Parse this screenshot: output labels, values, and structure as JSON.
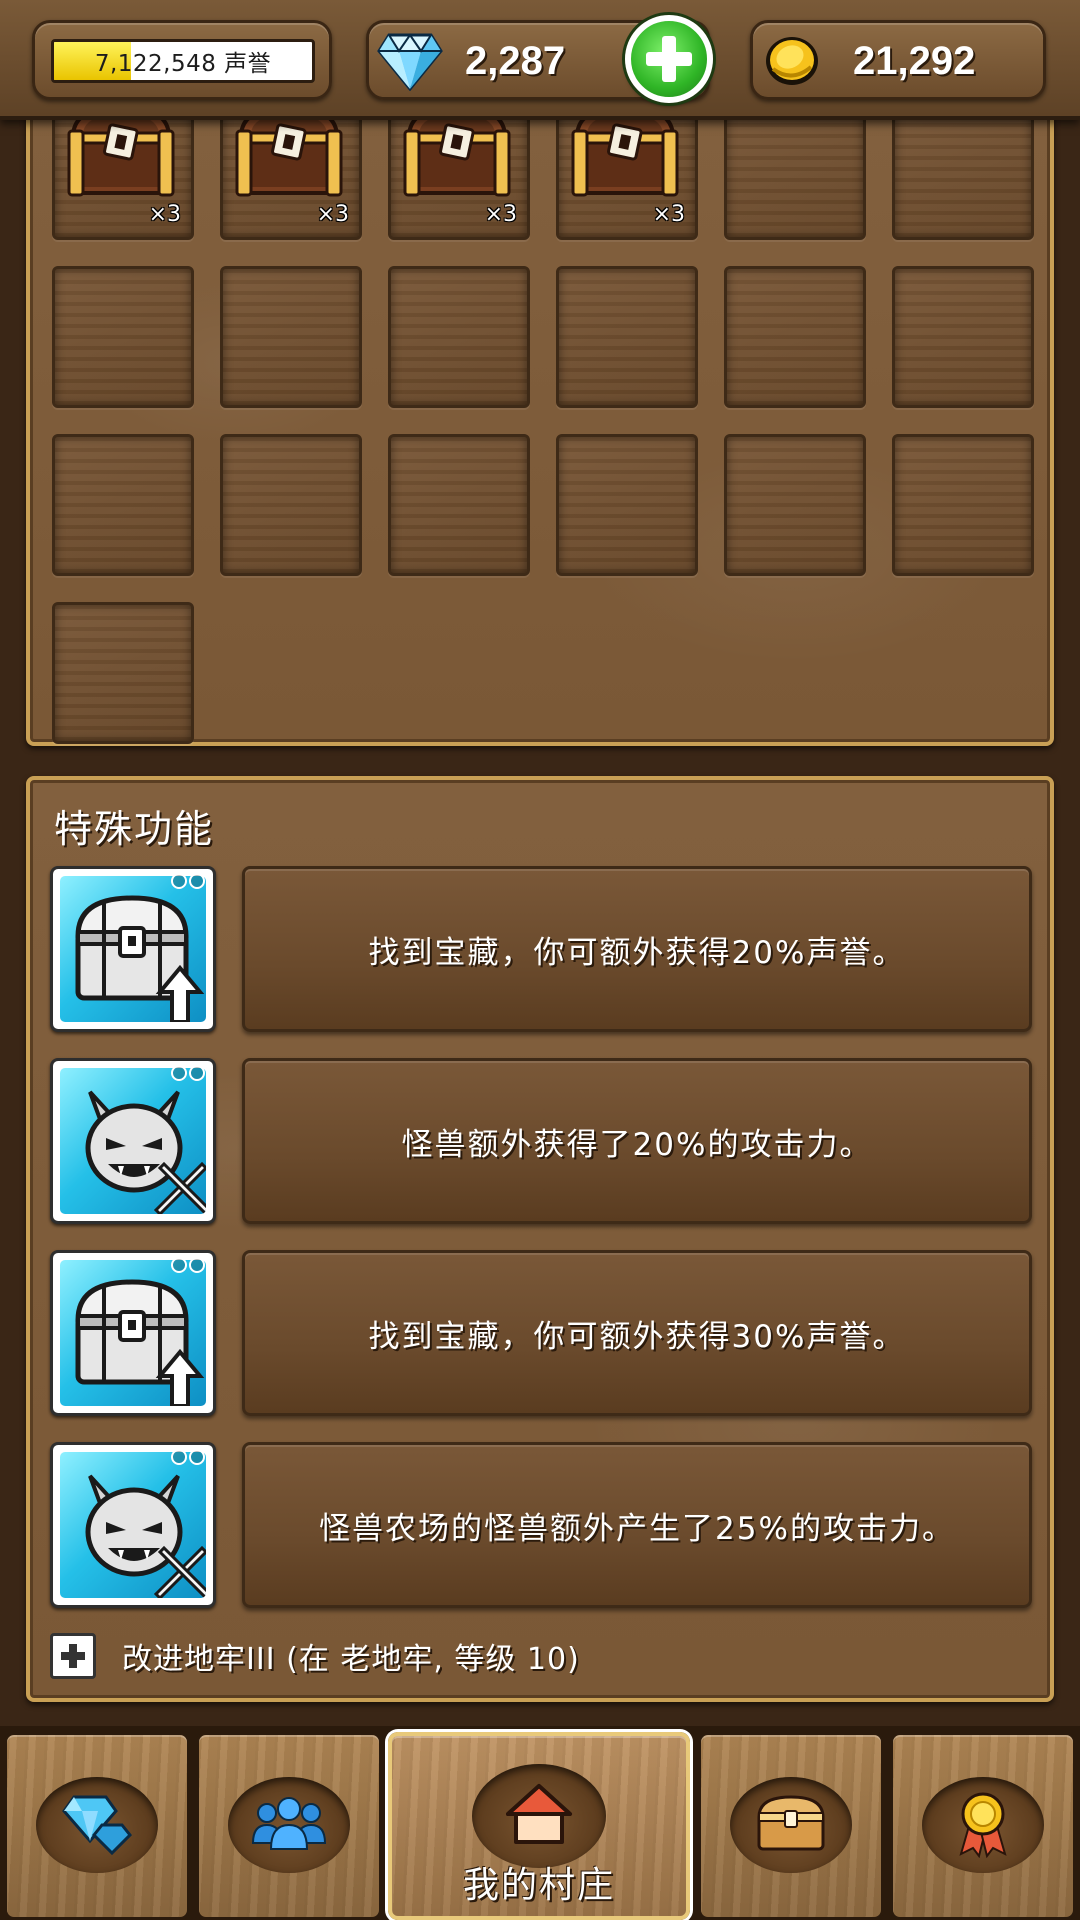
{
  "topbar": {
    "fame": {
      "text": "7,122,548 声誉",
      "fill_fraction": 0.3
    },
    "gems": {
      "value": "2,287"
    },
    "gold": {
      "value": "21,292"
    }
  },
  "inventory": {
    "slots": [
      {
        "item": "treasure-chest",
        "qty": "×3"
      },
      {
        "item": "treasure-chest",
        "qty": "×3"
      },
      {
        "item": "treasure-chest",
        "qty": "×3"
      },
      {
        "item": "treasure-chest",
        "qty": "×3"
      },
      {
        "item": null
      },
      {
        "item": null
      },
      {
        "item": null
      },
      {
        "item": null
      },
      {
        "item": null
      },
      {
        "item": null
      },
      {
        "item": null
      },
      {
        "item": null
      },
      {
        "item": null
      },
      {
        "item": null
      },
      {
        "item": null
      },
      {
        "item": null
      },
      {
        "item": null
      },
      {
        "item": null
      },
      {
        "item": null
      }
    ]
  },
  "special": {
    "title": "特殊功能",
    "features": [
      {
        "icon": "chest-up-icon",
        "text": "找到宝藏，你可额外获得20%声誉。"
      },
      {
        "icon": "monster-sword-icon",
        "text": "怪兽额外获得了20%的攻击力。"
      },
      {
        "icon": "chest-up-icon",
        "text": "找到宝藏，你可额外获得30%声誉。"
      },
      {
        "icon": "monster-sword-icon",
        "text": "怪兽农场的怪兽额外产生了25%的攻击力。"
      }
    ],
    "upgrade": {
      "text": "改进地牢III (在 老地牢, 等级 10)"
    }
  },
  "bottom_nav": {
    "items": [
      {
        "icon": "diamond-icon",
        "label": ""
      },
      {
        "icon": "people-icon",
        "label": ""
      },
      {
        "icon": "house-icon",
        "label": "我的村庄",
        "active": true
      },
      {
        "icon": "chest-icon",
        "label": ""
      },
      {
        "icon": "medal-icon",
        "label": ""
      }
    ]
  },
  "colors": {
    "wood_dark": "#3a2616",
    "panel_border": "#c9a055",
    "accent_green": "#2fb526",
    "fame_yellow": "#e9c400",
    "icon_blue": "#25c0e8"
  }
}
